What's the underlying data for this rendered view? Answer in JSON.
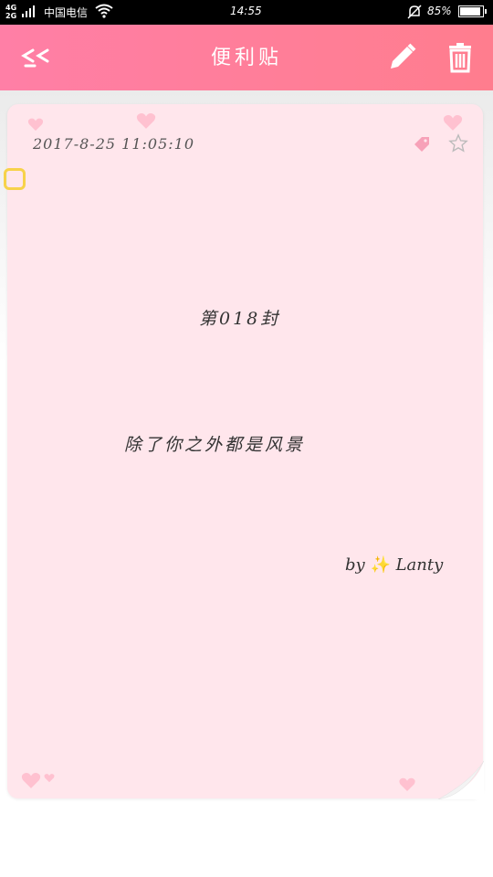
{
  "status_bar": {
    "network": "4G\n2G",
    "carrier": "中国电信",
    "time": "14:55",
    "battery": "85%"
  },
  "header": {
    "title": "便利贴",
    "back_icon": "double-chevron-left-icon",
    "edit_icon": "pencil-icon",
    "delete_icon": "trash-icon"
  },
  "note": {
    "date": "2017-8-25  11:05:10",
    "tag_icon": "tag-icon",
    "favorite_icon": "star-icon",
    "lines": [
      "第018封",
      "除了你之外都是风景"
    ],
    "signature_prefix": "by",
    "signature_sparkle": "✨",
    "signature_name": "Lanty"
  },
  "colors": {
    "header_start": "#ff7fa6",
    "header_end": "#ff7d8e",
    "card_background": "#ffe6ec",
    "heart": "#ffc1d0",
    "tag": "#f7a1b8"
  }
}
